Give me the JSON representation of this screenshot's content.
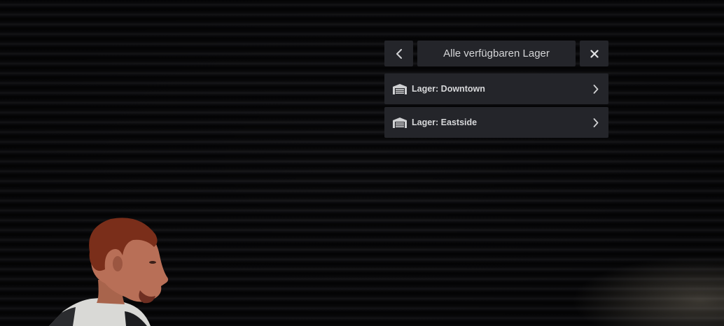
{
  "menu": {
    "title": "Alle verfügbaren Lager",
    "back_icon": "chevron-left-icon",
    "close_icon": "close-icon",
    "items": [
      {
        "label": "Lager: Downtown",
        "icon": "warehouse-icon",
        "chevron": "chevron-right-icon"
      },
      {
        "label": "Lager: Eastside",
        "icon": "warehouse-icon",
        "chevron": "chevron-right-icon"
      }
    ]
  },
  "colors": {
    "panel": "#24252a",
    "text": "#d5d6d8",
    "icon": "#d0d1d3"
  }
}
